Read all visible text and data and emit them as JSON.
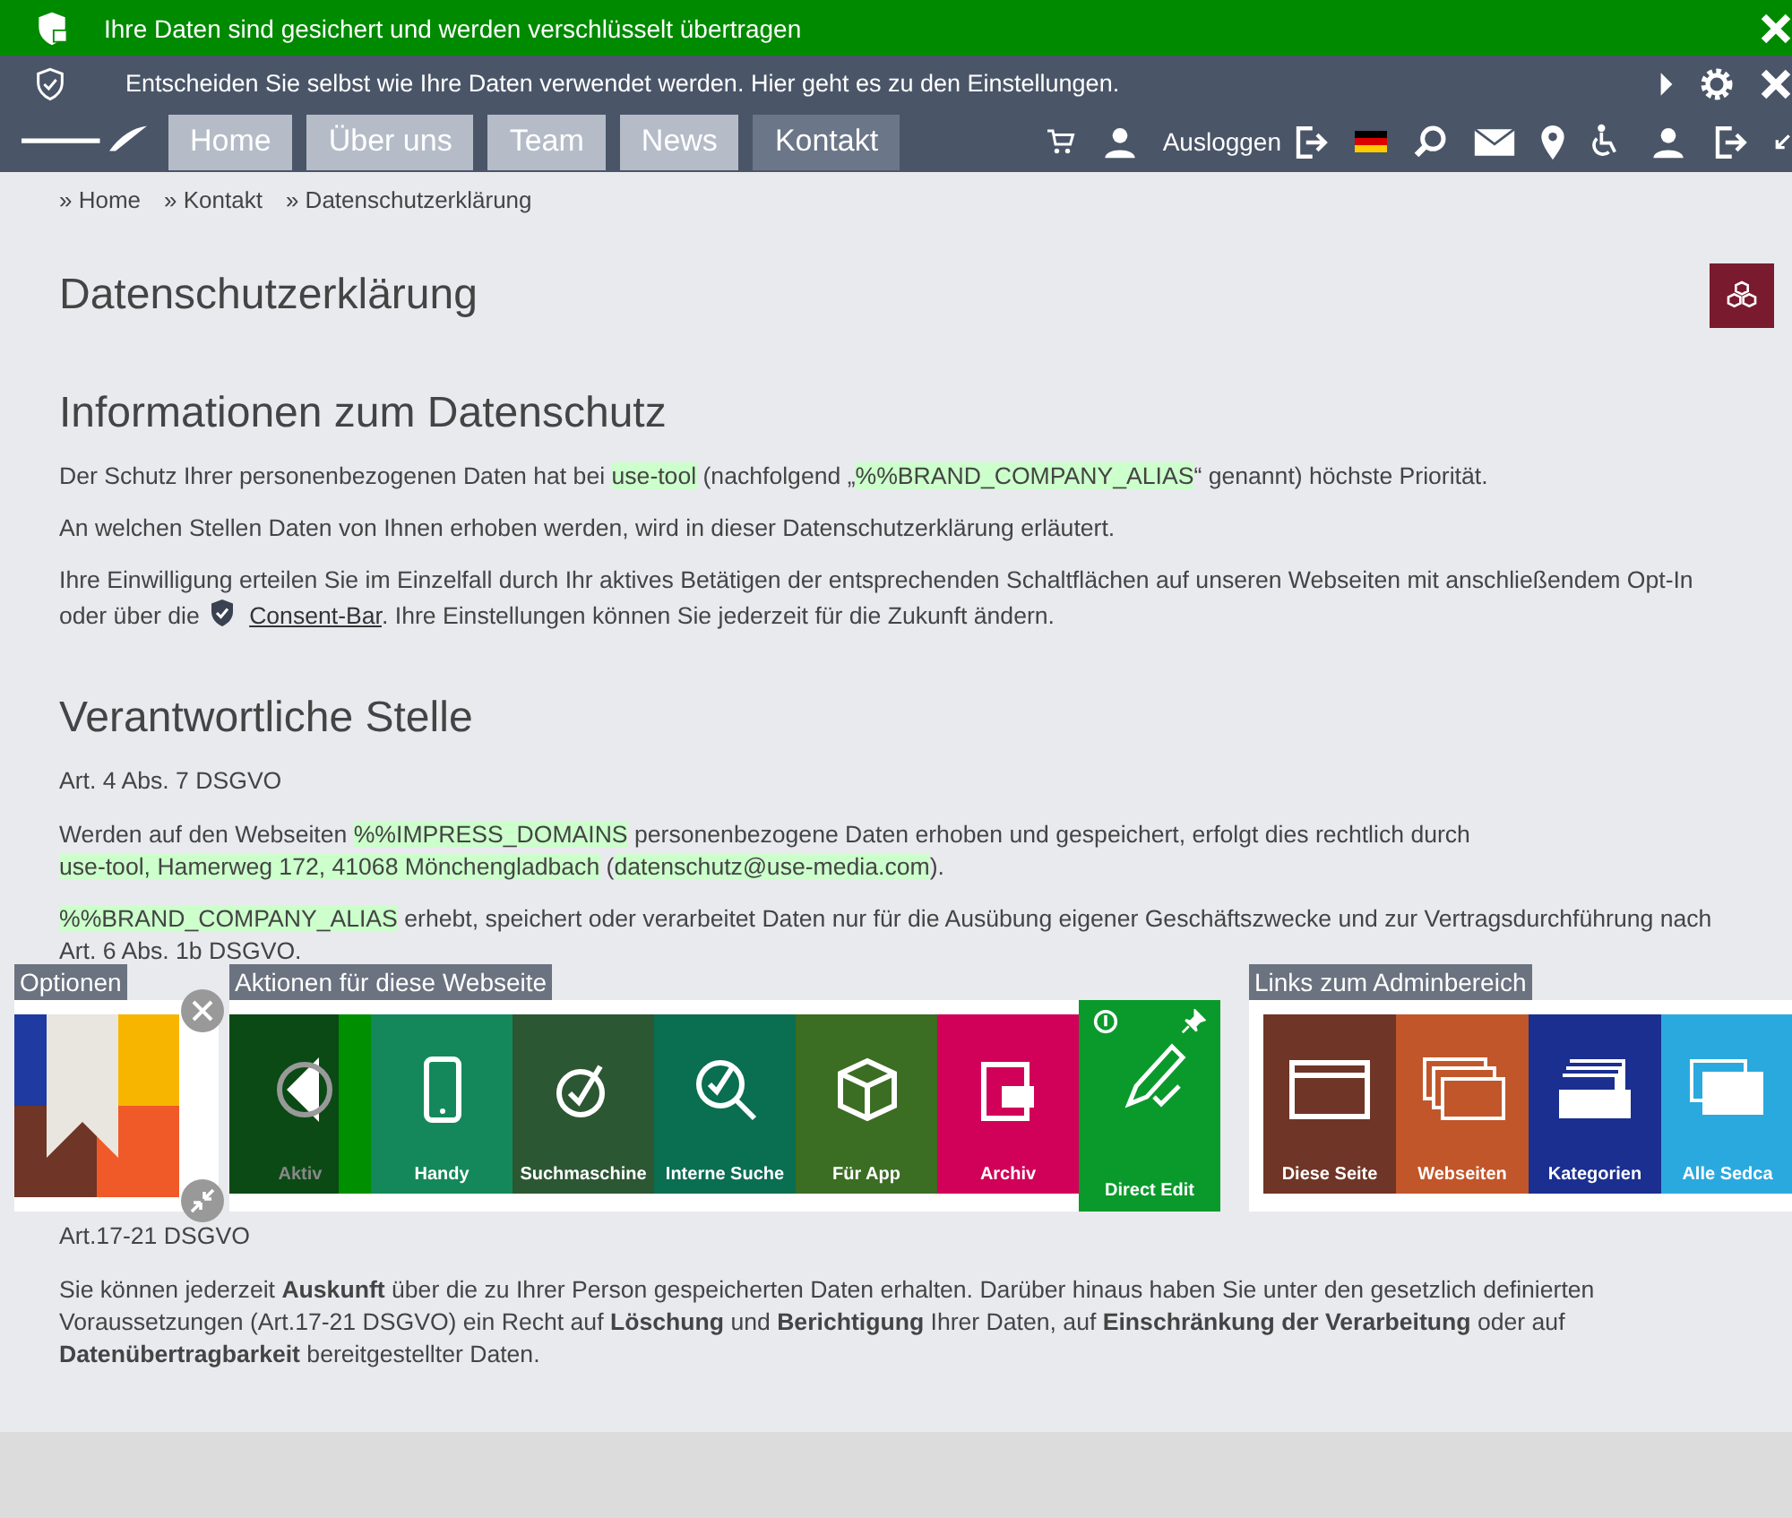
{
  "ssl_bar": {
    "text": "Ihre Daten sind gesichert und werden verschlüsselt übertragen"
  },
  "consent_bar": {
    "text": "Entscheiden Sie selbst wie Ihre Daten verwendet werden. Hier geht es zu den Einstellungen."
  },
  "nav": {
    "items": [
      {
        "label": "Home",
        "selected": false
      },
      {
        "label": "Über uns",
        "selected": false
      },
      {
        "label": "Team",
        "selected": false
      },
      {
        "label": "News",
        "selected": false
      },
      {
        "label": "Kontakt",
        "selected": true
      }
    ],
    "logout": "Ausloggen"
  },
  "breadcrumb": [
    "» Home",
    "» Kontakt",
    "» Datenschutzerklärung"
  ],
  "page_title": "Datenschutzerklärung",
  "sections": [
    {
      "heading": "Informationen zum Datenschutz",
      "blocks": [
        {
          "kind": "para",
          "parts": [
            {
              "kind": "plain",
              "text": "Der Schutz Ihrer personenbezogenen Daten hat bei "
            },
            {
              "kind": "mark",
              "text": "use-tool"
            },
            {
              "kind": "plain",
              "text": " (nachfolgend „"
            },
            {
              "kind": "mark",
              "text": "%%BRAND_COMPANY_ALIAS"
            },
            {
              "kind": "plain",
              "text": "“ genannt) höchste Priorität."
            }
          ]
        },
        {
          "kind": "para",
          "parts": [
            {
              "kind": "plain",
              "text": "An welchen Stellen Daten von Ihnen erhoben werden, wird in dieser Datenschutzerklärung erläutert."
            }
          ]
        },
        {
          "kind": "para",
          "parts": [
            {
              "kind": "plain",
              "text": "Ihre Einwilligung erteilen Sie im Einzelfall durch Ihr aktives Betätigen der entsprechenden Schaltflächen auf unseren Webseiten mit anschließendem Opt-In oder über die "
            },
            {
              "kind": "shield"
            },
            {
              "kind": "link",
              "text": "Consent-Bar"
            },
            {
              "kind": "plain",
              "text": ". Ihre Einstellungen können Sie jederzeit für die Zukunft ändern."
            }
          ]
        }
      ]
    },
    {
      "heading": "Verantwortliche Stelle",
      "blocks": [
        {
          "kind": "label",
          "parts": [
            {
              "kind": "plain",
              "text": "Art. 4 Abs. 7 DSGVO"
            }
          ]
        },
        {
          "kind": "para",
          "parts": [
            {
              "kind": "plain",
              "text": "Werden auf den Webseiten "
            },
            {
              "kind": "mark",
              "text": "%%IMPRESS_DOMAINS"
            },
            {
              "kind": "plain",
              "text": " personenbezogene Daten erhoben und gespeichert, erfolgt dies rechtlich durch"
            },
            {
              "kind": "break"
            },
            {
              "kind": "mark",
              "text": "use-tool, Hamerweg 172, 41068 Mönchengladbach"
            },
            {
              "kind": "plain",
              "text": " ("
            },
            {
              "kind": "mark",
              "text": "datenschutz@use-media.com"
            },
            {
              "kind": "plain",
              "text": ")."
            }
          ]
        },
        {
          "kind": "para",
          "parts": [
            {
              "kind": "mark",
              "text": "%%BRAND_COMPANY_ALIAS"
            },
            {
              "kind": "plain",
              "text": " erhebt, speichert oder verarbeitet Daten nur für die Ausübung eigener Geschäftszwecke und zur Vertragsdurchführung nach Art. 6 Abs. 1b DSGVO."
            }
          ]
        },
        {
          "kind": "gap"
        },
        {
          "kind": "label",
          "parts": [
            {
              "kind": "plain",
              "text": "Art.17-21 DSGVO"
            }
          ]
        },
        {
          "kind": "para",
          "parts": [
            {
              "kind": "plain",
              "text": "Sie können jederzeit "
            },
            {
              "kind": "bold",
              "text": "Auskunft"
            },
            {
              "kind": "plain",
              "text": " über die zu Ihrer Person gespeicherten Daten erhalten. Darüber hinaus haben Sie unter den gesetzlich definierten Voraussetzungen (Art.17-21 DSGVO) ein Recht auf "
            },
            {
              "kind": "bold",
              "text": "Löschung"
            },
            {
              "kind": "plain",
              "text": " und "
            },
            {
              "kind": "bold",
              "text": "Berichtigung"
            },
            {
              "kind": "plain",
              "text": " Ihrer Daten, auf "
            },
            {
              "kind": "bold",
              "text": "Einschränkung der Verarbeitung"
            },
            {
              "kind": "plain",
              "text": " oder auf "
            },
            {
              "kind": "bold",
              "text": "Datenübertragbarkeit"
            },
            {
              "kind": "plain",
              "text": " bereitgestellter Daten."
            }
          ]
        }
      ]
    }
  ],
  "admin": {
    "options_title": "Optionen",
    "actions_title": "Aktionen für diese Webseite",
    "links_title": "Links zum Adminbereich",
    "actions": [
      {
        "label": "Aktiv",
        "kind": "toggle",
        "color": "#0b4a14"
      },
      {
        "label": "Handy",
        "kind": "phone",
        "color": "#14885a"
      },
      {
        "label": "Suchmaschine",
        "kind": "seo",
        "color": "#2c5733"
      },
      {
        "label": "Interne Suche",
        "kind": "search",
        "color": "#0a6e50"
      },
      {
        "label": "Für App",
        "kind": "box",
        "color": "#3b6d23"
      },
      {
        "label": "Archiv",
        "kind": "archive",
        "color": "#d10058"
      },
      {
        "label": "Direct Edit",
        "kind": "edit",
        "color": "#0a9a2c"
      }
    ],
    "links": [
      {
        "label": "Diese Seite",
        "kind": "window",
        "color": "#6f3526"
      },
      {
        "label": "Webseiten",
        "kind": "windows",
        "color": "#c1562a"
      },
      {
        "label": "Kategorien",
        "kind": "cards",
        "color": "#1a2f8f"
      },
      {
        "label": "Alle Sedca",
        "kind": "docs",
        "color": "#2aa9df"
      }
    ]
  }
}
